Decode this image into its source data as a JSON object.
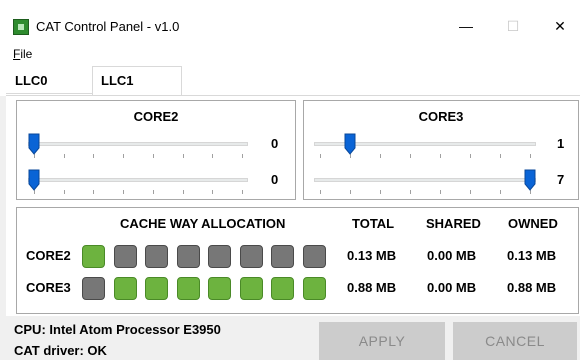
{
  "window": {
    "title": "CAT Control Panel - v1.0",
    "minimize": "—",
    "maximize": "☐",
    "close": "✕"
  },
  "menu": {
    "file_hotkey": "F",
    "file_rest": "ile"
  },
  "tabs": [
    {
      "label": "LLC0"
    },
    {
      "label": "LLC1"
    }
  ],
  "selected_tab": "LLC1",
  "cores": [
    {
      "title": "CORE2",
      "sliders": [
        {
          "value": "0"
        },
        {
          "value": "0"
        }
      ]
    },
    {
      "title": "CORE3",
      "sliders": [
        {
          "value": "1"
        },
        {
          "value": "7"
        }
      ]
    }
  ],
  "slider_range": [
    0,
    7
  ],
  "allocation": {
    "title": "CACHE WAY ALLOCATION",
    "headers": {
      "total": "TOTAL",
      "shared": "SHARED",
      "owned": "OWNED"
    },
    "rows": [
      {
        "label": "CORE2",
        "ways": [
          1,
          0,
          0,
          0,
          0,
          0,
          0,
          0
        ],
        "total": "0.13 MB",
        "shared": "0.00 MB",
        "owned": "0.13 MB"
      },
      {
        "label": "CORE3",
        "ways": [
          0,
          1,
          1,
          1,
          1,
          1,
          1,
          1
        ],
        "total": "0.88 MB",
        "shared": "0.00 MB",
        "owned": "0.88 MB"
      }
    ]
  },
  "status": {
    "cpu": "CPU: Intel Atom Processor E3950",
    "driver": "CAT driver: OK"
  },
  "buttons": {
    "apply": "APPLY",
    "cancel": "CANCEL"
  },
  "colors": {
    "way_on": "#6db33f",
    "way_off": "#777777",
    "thumb": "#0a64d6"
  },
  "icons": {
    "app": "app-icon",
    "minimize": "minimize-icon",
    "maximize": "maximize-icon",
    "close": "close-icon"
  }
}
